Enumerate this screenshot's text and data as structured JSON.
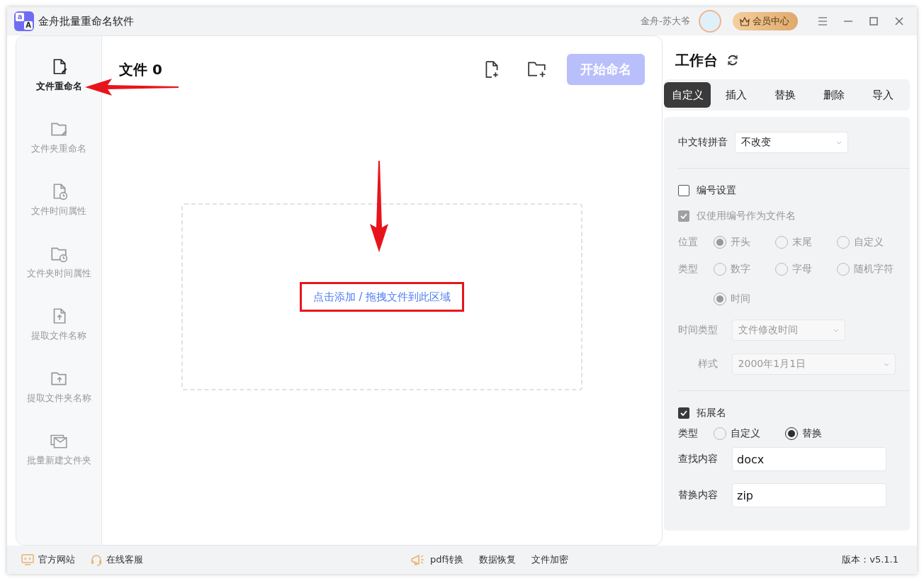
{
  "window": {
    "logo_letters": [
      "a",
      "A"
    ],
    "title": "金舟批量重命名软件",
    "user_name": "金舟-苏大爷",
    "vip_button": "会员中心"
  },
  "sidebar": {
    "items": [
      {
        "label": "文件重命名",
        "kind": "file-edit",
        "selected": true
      },
      {
        "label": "文件夹重命名",
        "kind": "folder-edit",
        "selected": false
      },
      {
        "label": "文件时间属性",
        "kind": "file-clock",
        "selected": false
      },
      {
        "label": "文件夹时间属性",
        "kind": "folder-clock",
        "selected": false
      },
      {
        "label": "提取文件名称",
        "kind": "file-up",
        "selected": false
      },
      {
        "label": "提取文件夹名称",
        "kind": "folder-up",
        "selected": false
      },
      {
        "label": "批量新建文件夹",
        "kind": "folder-mail",
        "selected": false
      }
    ]
  },
  "main": {
    "title": "文件 0",
    "start_button": {
      "label": "开始命名",
      "disabled": true
    },
    "dropzone_text": "点击添加 / 拖拽文件到此区域"
  },
  "workbench": {
    "title": "工作台",
    "tabs": [
      {
        "label": "自定义",
        "selected": true
      },
      {
        "label": "插入",
        "selected": false
      },
      {
        "label": "替换",
        "selected": false
      },
      {
        "label": "删除",
        "selected": false
      },
      {
        "label": "导入",
        "selected": false
      }
    ],
    "pinyin": {
      "label": "中文转拼音",
      "value": "不改变"
    },
    "numbering": {
      "label": "编号设置",
      "checked": false
    },
    "numbering_options": {
      "disabled": true,
      "only_number": {
        "label": "仅使用编号作为文件名",
        "checked": true
      },
      "position": {
        "label": "位置",
        "options": [
          {
            "label": "开头",
            "selected": true
          },
          {
            "label": "末尾",
            "selected": false
          },
          {
            "label": "自定义",
            "selected": false
          }
        ]
      },
      "type": {
        "label": "类型",
        "options": [
          {
            "label": "数字",
            "selected": false
          },
          {
            "label": "字母",
            "selected": false
          },
          {
            "label": "随机字符",
            "selected": false
          },
          {
            "label": "时间",
            "selected": true
          }
        ]
      },
      "time_type": {
        "label": "时间类型",
        "value": "文件修改时间"
      },
      "style": {
        "label": "样式",
        "value": "2000年1月1日"
      }
    },
    "extension": {
      "label": "拓展名",
      "checked": true,
      "type": {
        "label": "类型",
        "options": [
          {
            "label": "自定义",
            "selected": false
          },
          {
            "label": "替换",
            "selected": true
          }
        ]
      },
      "find": {
        "label": "查找内容",
        "value": "docx"
      },
      "replace": {
        "label": "替换内容",
        "value": "zip"
      }
    }
  },
  "status_bar": {
    "left_links": [
      {
        "label": "官方网站",
        "kind": "website"
      },
      {
        "label": "在线客服",
        "kind": "support"
      }
    ],
    "center_links": [
      {
        "label": "pdf转换",
        "kind": "promo"
      },
      {
        "label": "数据恢复",
        "kind": "plain"
      },
      {
        "label": "文件加密",
        "kind": "plain"
      }
    ],
    "version": "版本：v5.1.1"
  }
}
